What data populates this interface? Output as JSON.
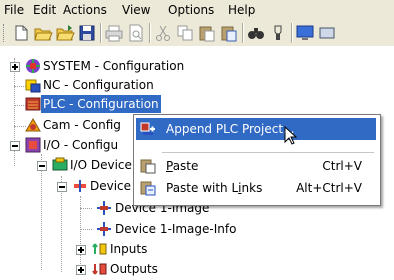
{
  "menubar": {
    "file": "File",
    "edit": "Edit",
    "actions": "Actions",
    "view": "View",
    "options": "Options",
    "help": "Help"
  },
  "tree": {
    "system": "SYSTEM - Configuration",
    "nc": "NC - Configuration",
    "plc": "PLC - Configuration",
    "cam": "Cam - Config",
    "io": "I/O - Configu",
    "io_devices": "I/O Device",
    "device1": "Device",
    "device1_image": "Device 1-Image",
    "device1_image_info": "Device 1-Image-Info",
    "inputs": "Inputs",
    "outputs": "Outputs"
  },
  "context_menu": {
    "append_plc": "Append PLC Project...",
    "paste": "Paste",
    "paste_shortcut": "Ctrl+V",
    "paste_links": "Paste with Links",
    "paste_links_shortcut": "Alt+Ctrl+V"
  },
  "icons": {
    "expand": "expand-icon",
    "collapse": "collapse-icon",
    "system": "system-config-icon",
    "nc": "nc-config-icon",
    "plc": "plc-config-icon",
    "cam": "cam-config-icon",
    "io": "io-config-icon"
  },
  "colors": {
    "selection": "#316ac5",
    "chrome": "#ece9d8"
  }
}
